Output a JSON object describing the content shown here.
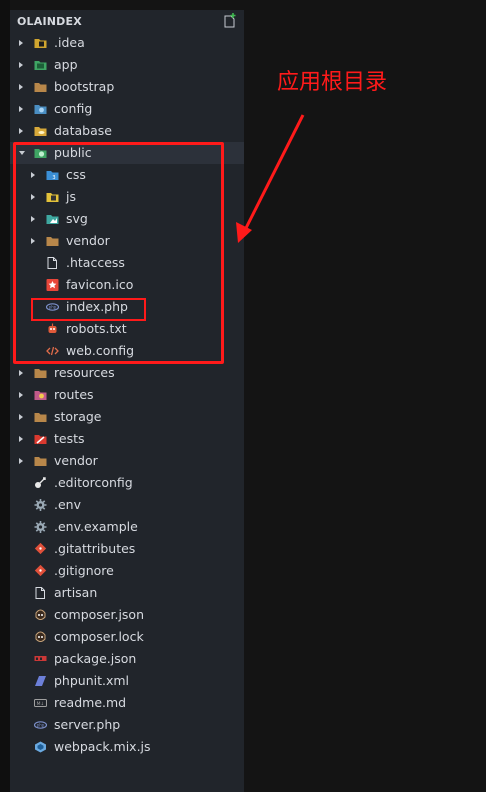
{
  "explorer": {
    "title": "OLAINDEX",
    "items": [
      {
        "label": ".idea",
        "kind": "folder",
        "icon": "idea-folder-icon",
        "color": "#d0a52f",
        "depth": 0,
        "expanded": false
      },
      {
        "label": "app",
        "kind": "folder",
        "icon": "app-folder-icon",
        "color": "#3fa564",
        "depth": 0,
        "expanded": false
      },
      {
        "label": "bootstrap",
        "kind": "folder",
        "icon": "folder-icon",
        "color": "#b8874a",
        "depth": 0,
        "expanded": false
      },
      {
        "label": "config",
        "kind": "folder",
        "icon": "config-folder-icon",
        "color": "#4a8ec2",
        "depth": 0,
        "expanded": false
      },
      {
        "label": "database",
        "kind": "folder",
        "icon": "database-folder-icon",
        "color": "#d7a93a",
        "depth": 0,
        "expanded": false
      },
      {
        "label": "public",
        "kind": "folder",
        "icon": "public-folder-icon",
        "color": "#3fa564",
        "depth": 0,
        "expanded": true
      },
      {
        "label": "css",
        "kind": "folder",
        "icon": "css-folder-icon",
        "color": "#3b8fd6",
        "depth": 1,
        "expanded": false
      },
      {
        "label": "js",
        "kind": "folder",
        "icon": "js-folder-icon",
        "color": "#e3c23a",
        "depth": 1,
        "expanded": false
      },
      {
        "label": "svg",
        "kind": "folder",
        "icon": "svg-folder-icon",
        "color": "#3ea8a0",
        "depth": 1,
        "expanded": false
      },
      {
        "label": "vendor",
        "kind": "folder",
        "icon": "folder-icon",
        "color": "#b8874a",
        "depth": 1,
        "expanded": false
      },
      {
        "label": ".htaccess",
        "kind": "file",
        "icon": "file-icon",
        "color": "#d7dae0",
        "depth": 1
      },
      {
        "label": "favicon.ico",
        "kind": "file",
        "icon": "favicon-star-icon",
        "color": "#e8463a",
        "depth": 1
      },
      {
        "label": "index.php",
        "kind": "file",
        "icon": "php-icon",
        "color": "#7b8ec8",
        "depth": 1
      },
      {
        "label": "robots.txt",
        "kind": "file",
        "icon": "robot-icon",
        "color": "#e05a3a",
        "depth": 1
      },
      {
        "label": "web.config",
        "kind": "file",
        "icon": "code-brackets-icon",
        "color": "#e06c4a",
        "depth": 1
      },
      {
        "label": "resources",
        "kind": "folder",
        "icon": "folder-icon",
        "color": "#b8874a",
        "depth": 0,
        "expanded": false
      },
      {
        "label": "routes",
        "kind": "folder",
        "icon": "routes-folder-icon",
        "color": "#c25a8a",
        "depth": 0,
        "expanded": false
      },
      {
        "label": "storage",
        "kind": "folder",
        "icon": "folder-icon",
        "color": "#b8874a",
        "depth": 0,
        "expanded": false
      },
      {
        "label": "tests",
        "kind": "folder",
        "icon": "tests-folder-icon",
        "color": "#d9392f",
        "depth": 0,
        "expanded": false
      },
      {
        "label": "vendor",
        "kind": "folder",
        "icon": "folder-icon",
        "color": "#b8874a",
        "depth": 0,
        "expanded": false
      },
      {
        "label": ".editorconfig",
        "kind": "file",
        "icon": "editorconfig-icon",
        "color": "#e8e8e8",
        "depth": 0
      },
      {
        "label": ".env",
        "kind": "file",
        "icon": "gear-icon",
        "color": "#9aa9b5",
        "depth": 0
      },
      {
        "label": ".env.example",
        "kind": "file",
        "icon": "gear-icon",
        "color": "#9aa9b5",
        "depth": 0
      },
      {
        "label": ".gitattributes",
        "kind": "file",
        "icon": "git-icon",
        "color": "#e0503a",
        "depth": 0
      },
      {
        "label": ".gitignore",
        "kind": "file",
        "icon": "git-icon",
        "color": "#e0503a",
        "depth": 0
      },
      {
        "label": "artisan",
        "kind": "file",
        "icon": "file-icon",
        "color": "#d7dae0",
        "depth": 0
      },
      {
        "label": "composer.json",
        "kind": "file",
        "icon": "composer-icon",
        "color": "#c7a37a",
        "depth": 0
      },
      {
        "label": "composer.lock",
        "kind": "file",
        "icon": "composer-icon",
        "color": "#c7a37a",
        "depth": 0
      },
      {
        "label": "package.json",
        "kind": "file",
        "icon": "npm-icon",
        "color": "#cb3837",
        "depth": 0
      },
      {
        "label": "phpunit.xml",
        "kind": "file",
        "icon": "phpunit-icon",
        "color": "#6c7fd8",
        "depth": 0
      },
      {
        "label": "readme.md",
        "kind": "file",
        "icon": "markdown-icon",
        "color": "#a0a0a0",
        "depth": 0
      },
      {
        "label": "server.php",
        "kind": "file",
        "icon": "php-icon",
        "color": "#7b8ec8",
        "depth": 0
      },
      {
        "label": "webpack.mix.js",
        "kind": "file",
        "icon": "webpack-icon",
        "color": "#6aa9e0",
        "depth": 0
      }
    ]
  },
  "annotation": {
    "text": "应用根目录",
    "color": "#ff1a1a"
  }
}
